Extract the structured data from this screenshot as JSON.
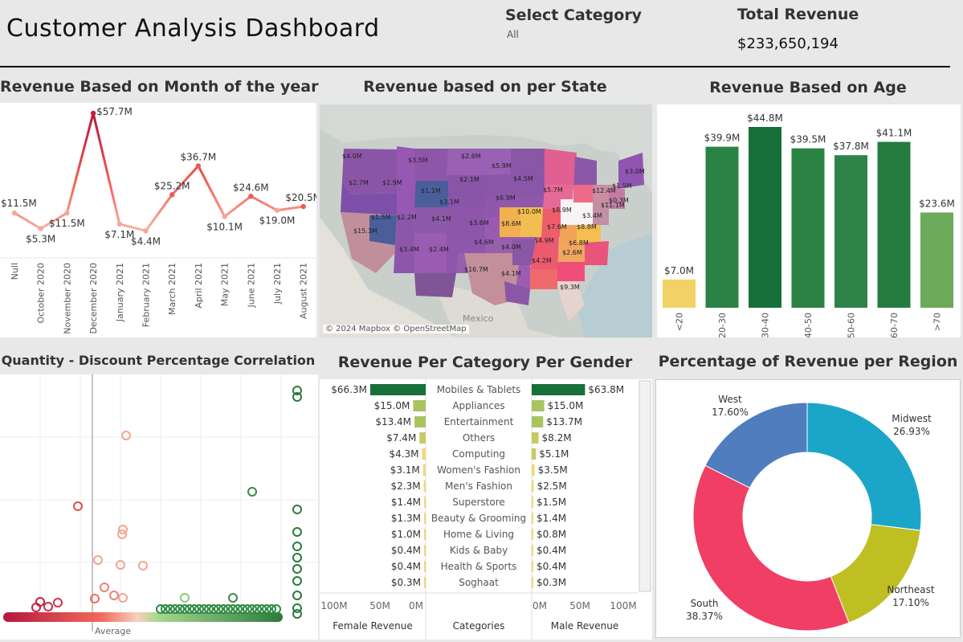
{
  "header": {
    "title": "Customer Analysis Dashboard",
    "filter_label": "Select Category",
    "filter_value": "All",
    "total_revenue_label": "Total Revenue",
    "total_revenue_value": "$233,650,194"
  },
  "panels": {
    "month": "Revenue Based on Month of the year",
    "state": "Revenue based on per State",
    "age": "Revenue Based on Age",
    "quantity": "Quantity - Discount Percentage Correlation",
    "category_gender": "Revenue Per Category Per Gender",
    "region": "Percentage of Revenue per Region"
  },
  "map": {
    "attribution": "© 2024 Mapbox © OpenStreetMap",
    "country_label": "Mexico",
    "state_labels": [
      "$4.0M",
      "$3.5M",
      "$2.6M",
      "$5.9M",
      "$2.7M",
      "$1.9M",
      "$1.1M",
      "$2.1M",
      "$4.5M",
      "$3.0M",
      "$1.5M",
      "$12.4M",
      "$5.7M",
      "$3.1M",
      "$6.9M",
      "$11.1M",
      "$1.5M",
      "$2.2M",
      "$4.1M",
      "$3.6M",
      "$10.0M",
      "$8.9M",
      "$0.3M",
      "$15.3M",
      "$8.6M",
      "$7.6M",
      "$3.4M",
      "$8.8M",
      "$4.6M",
      "$4.9M",
      "$6.8M",
      "$3.4M",
      "$2.4M",
      "$4.0M",
      "$4.2M",
      "$2.6M",
      "$16.7M",
      "$4.1M",
      "$9.3M"
    ]
  },
  "quantity_chart": {
    "reference_line_label": "Average"
  },
  "chart_data": [
    {
      "id": "month",
      "type": "line",
      "title": "Revenue Based on Month of the year",
      "categories": [
        "Null",
        "October 2020",
        "November 2020",
        "December 2020",
        "January 2021",
        "February 2021",
        "March 2021",
        "April 2021",
        "May 2021",
        "June 2021",
        "July 2021",
        "August 2021"
      ],
      "values": [
        11.5,
        5.3,
        11.5,
        57.7,
        7.1,
        4.4,
        25.2,
        36.7,
        10.1,
        24.6,
        19.0,
        20.5
      ],
      "labels": [
        "$11.5M",
        "$5.3M",
        "$11.5M",
        "$57.7M",
        "$7.1M",
        "$4.4M",
        "$25.2M",
        "$36.7M",
        "$10.1M",
        "$24.6M",
        "$19.0M",
        "$20.5M"
      ],
      "unit": "M"
    },
    {
      "id": "age",
      "type": "bar",
      "title": "Revenue Based on Age",
      "categories": [
        "<20",
        "20-30",
        "30-40",
        "40-50",
        "50-60",
        "60-70",
        ">70"
      ],
      "values": [
        7.0,
        39.9,
        44.8,
        39.5,
        37.8,
        41.1,
        23.6
      ],
      "labels": [
        "$7.0M",
        "$39.9M",
        "$44.8M",
        "$39.5M",
        "$37.8M",
        "$41.1M",
        "$23.6M"
      ],
      "colors": [
        "#f2d264",
        "#2a8244",
        "#17703a",
        "#2a8244",
        "#2e8448",
        "#237b40",
        "#6aaa58"
      ]
    },
    {
      "id": "category_gender",
      "type": "bar",
      "title": "Revenue Per Category Per Gender",
      "categories": [
        "Mobiles & Tablets",
        "Appliances",
        "Entertainment",
        "Others",
        "Computing",
        "Women's Fashion",
        "Men's Fashion",
        "Superstore",
        "Beauty & Grooming",
        "Home & Living",
        "Kids & Baby",
        "Health & Sports",
        "Soghaat"
      ],
      "series": [
        {
          "name": "Female Revenue",
          "values": [
            66.3,
            15.0,
            13.4,
            7.4,
            4.3,
            3.1,
            2.3,
            1.4,
            1.3,
            1.0,
            0.4,
            0.4,
            0.3
          ],
          "labels": [
            "$66.3M",
            "$15.0M",
            "$13.4M",
            "$7.4M",
            "$4.3M",
            "$3.1M",
            "$2.3M",
            "$1.4M",
            "$1.3M",
            "$1.0M",
            "$0.4M",
            "$0.4M",
            "$0.3M"
          ]
        },
        {
          "name": "Male Revenue",
          "values": [
            63.8,
            15.0,
            13.7,
            8.2,
            5.1,
            3.5,
            2.5,
            1.5,
            1.4,
            0.8,
            0.4,
            0.4,
            0.3
          ],
          "labels": [
            "$63.8M",
            "$15.0M",
            "$13.7M",
            "$8.2M",
            "$5.1M",
            "$3.5M",
            "$2.5M",
            "$1.5M",
            "$1.4M",
            "$0.8M",
            "$0.4M",
            "$0.4M",
            "$0.3M"
          ]
        }
      ],
      "column_header": "Categories",
      "ticks": [
        "100M",
        "50M",
        "0M"
      ],
      "ticks_male": [
        "0M",
        "50M",
        "100M"
      ],
      "xlim": [
        0,
        100
      ]
    },
    {
      "id": "region",
      "type": "pie",
      "title": "Percentage of Revenue per Region",
      "categories": [
        "Midwest",
        "Northeast",
        "South",
        "West"
      ],
      "values": [
        26.93,
        17.1,
        38.37,
        17.6
      ],
      "labels": [
        "26.93%",
        "17.10%",
        "38.37%",
        "17.60%"
      ],
      "colors": [
        "#1ba6c9",
        "#bfbf24",
        "#f03e64",
        "#4f7dbe"
      ]
    }
  ]
}
